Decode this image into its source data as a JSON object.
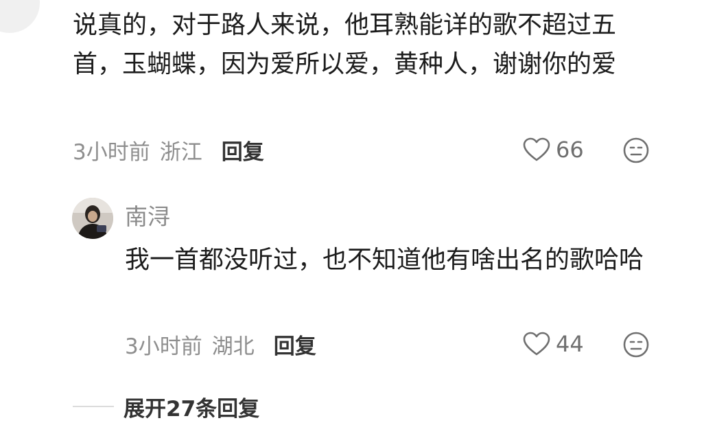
{
  "comment": {
    "text": "说真的，对于路人来说，他耳熟能详的歌不超过五首，玉蝴蝶，因为爱所以爱，黄种人，谢谢你的爱",
    "time": "3小时前",
    "location": "浙江",
    "reply_label": "回复",
    "likes": "66",
    "like_icon": "heart-outline-icon",
    "emoji_icon": "neutral-face-icon"
  },
  "reply": {
    "username": "南浔",
    "text": "我一首都没听过，也不知道他有啥出名的歌哈哈",
    "time": "3小时前",
    "location": "湖北",
    "reply_label": "回复",
    "likes": "44"
  },
  "expand": {
    "label": "展开27条回复"
  }
}
